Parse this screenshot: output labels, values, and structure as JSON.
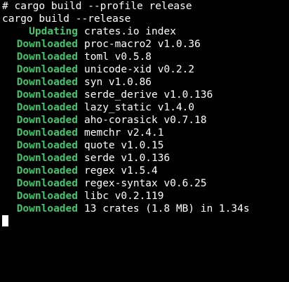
{
  "terminal": {
    "prompt_line": "# cargo build --profile release",
    "command_line": "cargo build --release",
    "lines": [
      {
        "status": "Updating",
        "message": "crates.io index"
      },
      {
        "status": "Downloaded",
        "message": "proc-macro2 v1.0.36"
      },
      {
        "status": "Downloaded",
        "message": "toml v0.5.8"
      },
      {
        "status": "Downloaded",
        "message": "unicode-xid v0.2.2"
      },
      {
        "status": "Downloaded",
        "message": "syn v1.0.86"
      },
      {
        "status": "Downloaded",
        "message": "serde_derive v1.0.136"
      },
      {
        "status": "Downloaded",
        "message": "lazy_static v1.4.0"
      },
      {
        "status": "Downloaded",
        "message": "aho-corasick v0.7.18"
      },
      {
        "status": "Downloaded",
        "message": "memchr v2.4.1"
      },
      {
        "status": "Downloaded",
        "message": "quote v1.0.15"
      },
      {
        "status": "Downloaded",
        "message": "serde v1.0.136"
      },
      {
        "status": "Downloaded",
        "message": "regex v1.5.4"
      },
      {
        "status": "Downloaded",
        "message": "regex-syntax v0.6.25"
      },
      {
        "status": "Downloaded",
        "message": "libc v0.2.119"
      },
      {
        "status": "Downloaded",
        "message": "13 crates (1.8 MB) in 1.34s"
      }
    ]
  },
  "colors": {
    "background": "#000000",
    "text": "#ffffff",
    "status_green": "#3ec76b"
  }
}
